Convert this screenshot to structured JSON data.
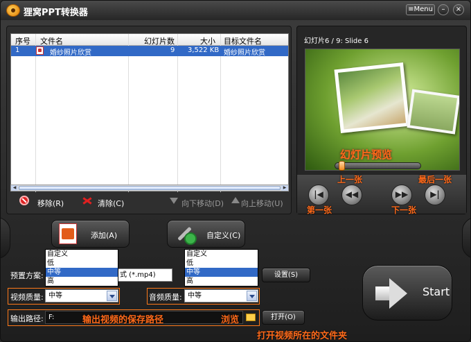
{
  "window": {
    "title": "狸窝PPT转换器",
    "menu_label": "Menu",
    "minimize": "–",
    "close": "×"
  },
  "file_list": {
    "columns": [
      "序号",
      "文件名",
      "幻灯片数",
      "大小",
      "目标文件名"
    ],
    "rows": [
      {
        "index": "1",
        "name": "婚纱照片欣赏",
        "slides": "9",
        "size": "3,522 KB",
        "target": "婚纱照片欣赏",
        "selected": true
      }
    ]
  },
  "file_actions": {
    "remove": "移除(R)",
    "clear": "清除(C)",
    "move_down": "向下移动(D)",
    "move_up": "向上移动(U)"
  },
  "preview": {
    "title": "幻灯片6 / 9: Slide 6",
    "overlay_label": "幻灯片预览",
    "progress": 0.05,
    "controls": {
      "first": "第一张",
      "prev": "上一张",
      "next": "下一张",
      "last": "最后一张"
    }
  },
  "buttons": {
    "add": "添加(A)",
    "custom": "自定义(C)"
  },
  "settings": {
    "preset_label": "预置方案:",
    "preset_value": "式 (*.mp4)",
    "preset_settings_button": "设置(S)",
    "video_quality_label": "视频质量:",
    "video_quality_value": "中等",
    "video_quality_options": [
      "自定义",
      "低",
      "中等",
      "高"
    ],
    "audio_quality_label": "音频质量:",
    "audio_quality_value": "中等",
    "audio_quality_options": [
      "自定义",
      "低",
      "中等",
      "高"
    ],
    "selected_option": "中等",
    "output_label": "输出路径:",
    "output_value": "F:",
    "output_hint": "输出视频的保存路径",
    "browse_hint": "浏览",
    "open_button": "打开(O)",
    "open_hint": "打开视频所在的文件夹"
  },
  "start_label": "Start",
  "colors": {
    "accent_annotation": "#ff6a1a",
    "selection": "#3169c6"
  }
}
